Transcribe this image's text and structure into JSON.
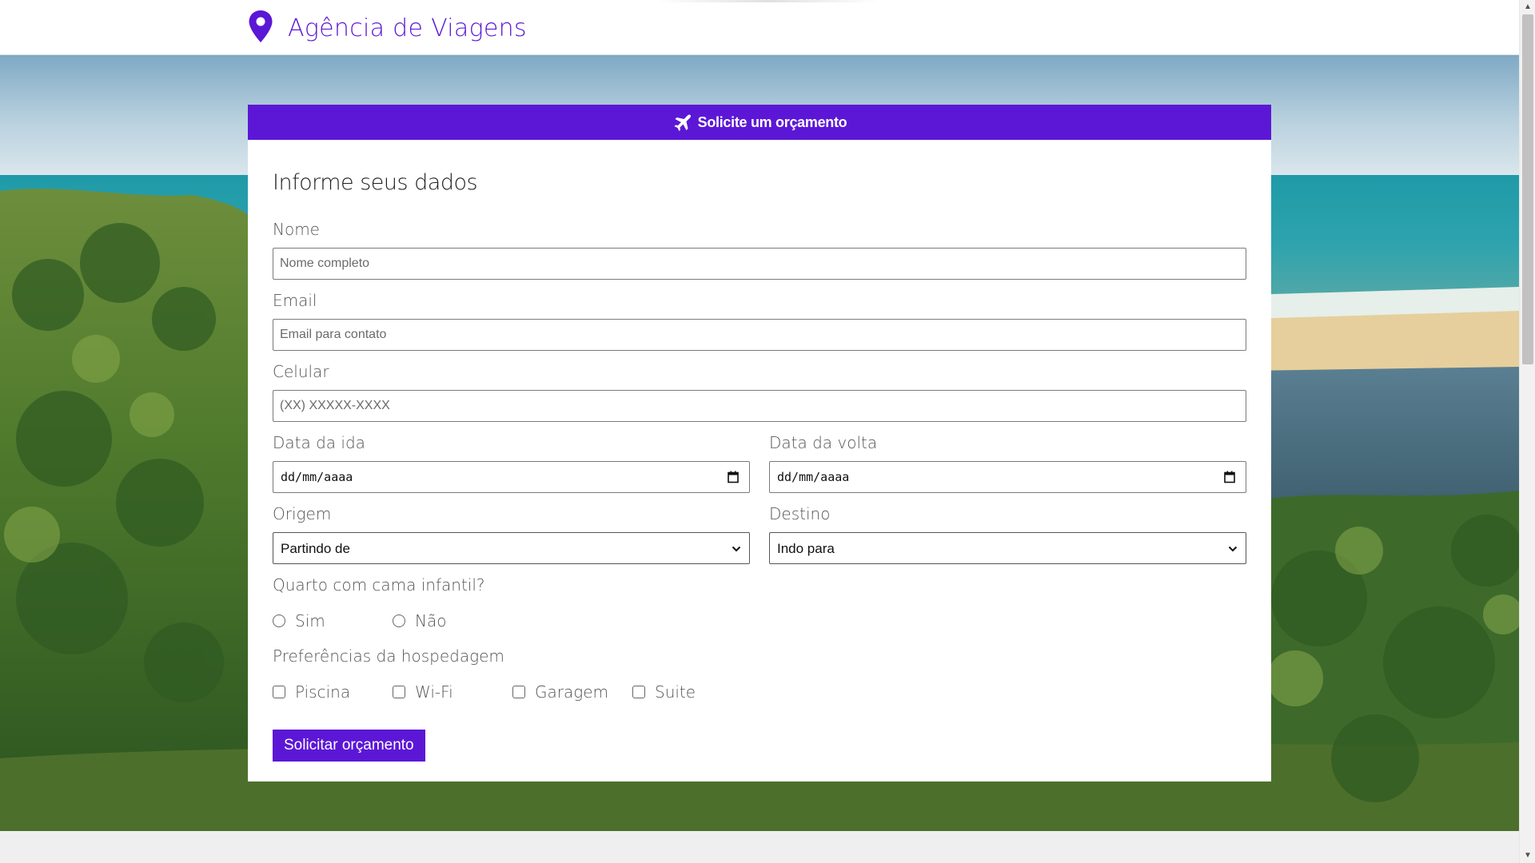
{
  "header": {
    "brand": "Agência de Viagens",
    "brand_color": "#5b17d6",
    "logo_icon": "map-pin-icon"
  },
  "card": {
    "title": "Solicite um orçamento",
    "title_icon": "plane-icon",
    "accent_color": "#5c17d6"
  },
  "form": {
    "heading": "Informe seus dados",
    "nome": {
      "label": "Nome",
      "placeholder": "Nome completo",
      "value": ""
    },
    "email": {
      "label": "Email",
      "placeholder": "Email para contato",
      "value": ""
    },
    "celular": {
      "label": "Celular",
      "placeholder": "(XX) XXXXX-XXXX",
      "value": ""
    },
    "data_ida": {
      "label": "Data da ida",
      "value": "dd/mm/aaaa"
    },
    "data_volta": {
      "label": "Data da volta",
      "value": "dd/mm/aaaa"
    },
    "origem": {
      "label": "Origem",
      "selected": "Partindo de"
    },
    "destino": {
      "label": "Destino",
      "selected": "Indo para"
    },
    "quarto": {
      "label": "Quarto com cama infantil?",
      "options": [
        "Sim",
        "Não"
      ]
    },
    "preferencias": {
      "label": "Preferências da hospedagem",
      "options": [
        "Piscina",
        "Wi-Fi",
        "Garagem",
        "Suite"
      ]
    },
    "submit_label": "Solicitar orçamento"
  }
}
